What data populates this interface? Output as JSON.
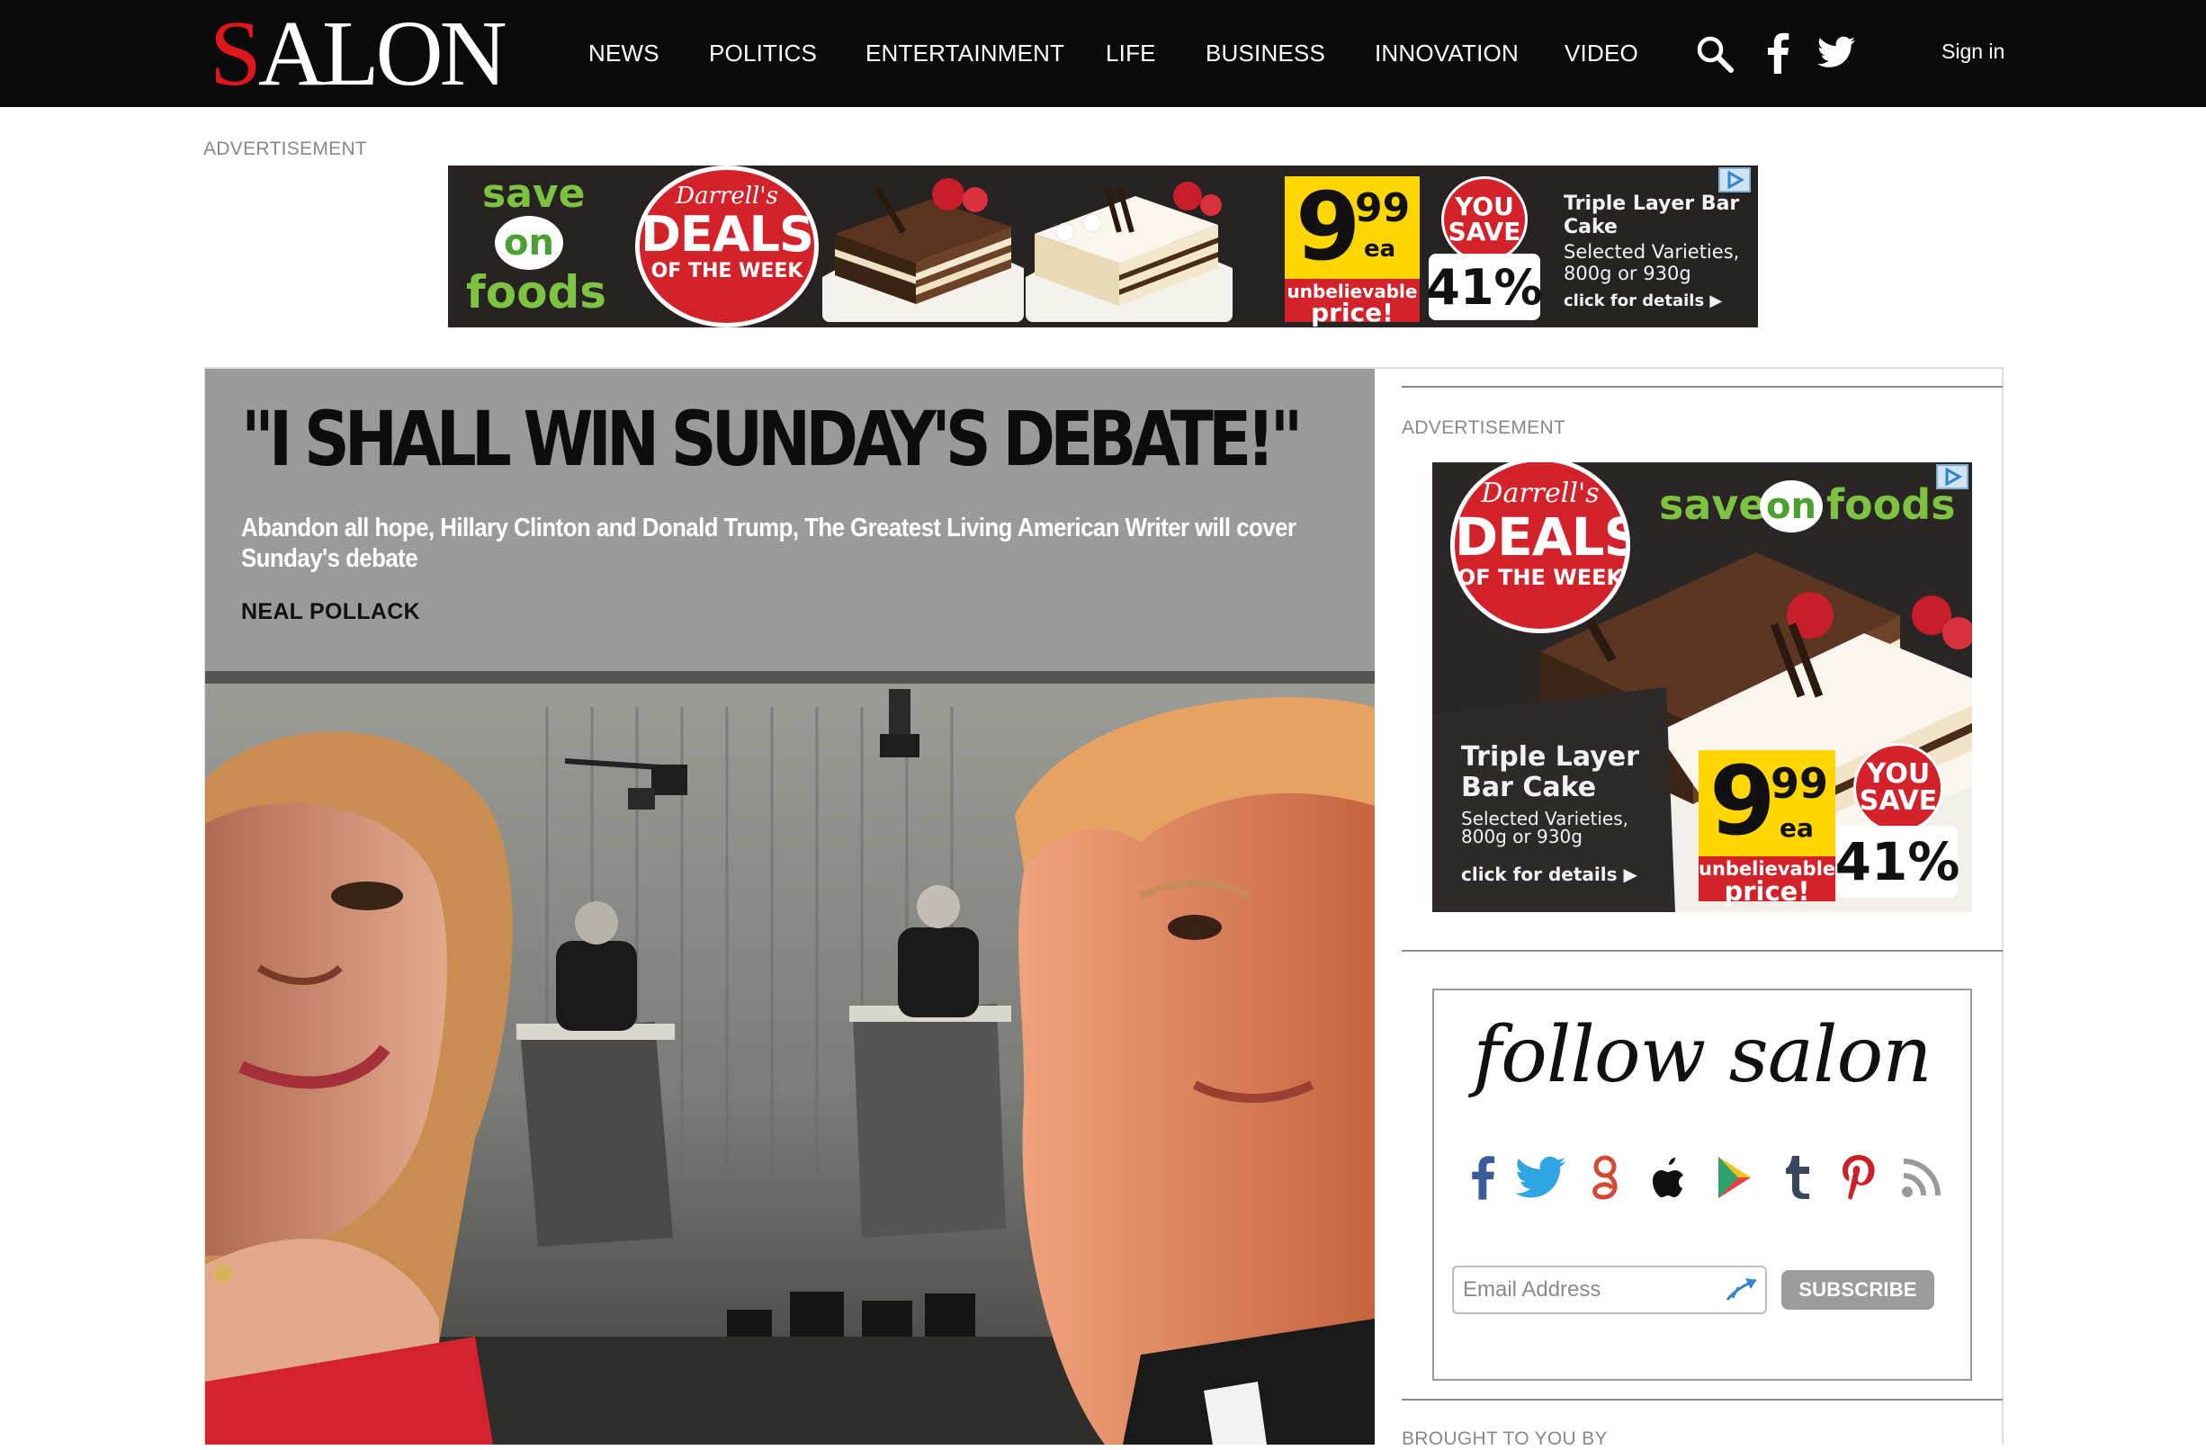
{
  "header": {
    "logo": "SALON",
    "nav": [
      "NEWS",
      "POLITICS",
      "ENTERTAINMENT",
      "LIFE",
      "BUSINESS",
      "INNOVATION",
      "VIDEO"
    ],
    "icons": [
      "search-icon",
      "facebook-icon",
      "twitter-icon"
    ],
    "signin": "Sign in"
  },
  "ads": {
    "top_label": "ADVERTISEMENT",
    "sidebar_label": "ADVERTISEMENT",
    "banner": {
      "brand": [
        "save",
        "on",
        "foods"
      ],
      "badge": [
        "Darrell's",
        "DEALS",
        "OF THE WEEK"
      ],
      "price_whole": "9",
      "price_cents": "99",
      "price_unit": "ea",
      "price_tag": [
        "unbelievable",
        "price!"
      ],
      "you_save": [
        "YOU",
        "SAVE"
      ],
      "percent": "41%",
      "product_title": [
        "Triple Layer Bar",
        "Cake"
      ],
      "product_detail": [
        "Selected Varieties,",
        "800g or 930g"
      ],
      "cta": "click for details ▶"
    },
    "square": {
      "brand": [
        "save",
        "on",
        "foods"
      ],
      "badge": [
        "Darrell's",
        "DEALS",
        "OF THE WEEK"
      ],
      "product_title": [
        "Triple Layer",
        "Bar Cake"
      ],
      "product_detail": [
        "Selected Varieties,",
        "800g or 930g"
      ],
      "cta": "click for details ▶",
      "price_whole": "9",
      "price_cents": "99",
      "price_unit": "ea",
      "price_tag": [
        "unbelievable",
        "price!"
      ],
      "you_save": [
        "YOU",
        "SAVE"
      ],
      "percent": "41%"
    }
  },
  "article": {
    "headline": "\"I SHALL WIN SUNDAY'S DEBATE!\"",
    "subhead": "Abandon all hope, Hillary Clinton and Donald Trump, The Greatest Living American Writer will cover Sunday's debate",
    "author": "NEAL POLLACK"
  },
  "sidebar": {
    "follow_title": "follow salon",
    "social": [
      "facebook-icon",
      "twitter-icon",
      "google-plus-icon",
      "apple-icon",
      "google-play-icon",
      "tumblr-icon",
      "pinterest-icon",
      "rss-icon"
    ],
    "email_placeholder": "Email Address",
    "subscribe_label": "SUBSCRIBE",
    "brought": "BROUGHT TO YOU BY"
  },
  "colors": {
    "nav_bg": "#0b0b0b",
    "logo_accent": "#e0161c",
    "hero_header_bg": "#9a9a9a",
    "ad_green": "#7ec242",
    "ad_red": "#d3222a",
    "ad_yellow": "#ffd600",
    "subscribe_bg": "#9c9c9c"
  }
}
